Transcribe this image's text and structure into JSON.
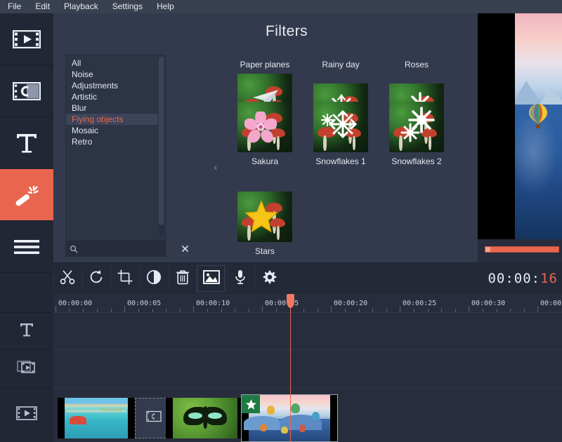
{
  "menubar": {
    "items": [
      {
        "label": "File"
      },
      {
        "label": "Edit"
      },
      {
        "label": "Playback"
      },
      {
        "label": "Settings"
      },
      {
        "label": "Help"
      }
    ]
  },
  "sidebar": {
    "items": [
      {
        "name": "import-media",
        "icon": "film-play-icon",
        "active": false
      },
      {
        "name": "transitions",
        "icon": "transition-icon",
        "active": false
      },
      {
        "name": "titles",
        "icon": "text-t-icon",
        "active": false
      },
      {
        "name": "filters",
        "icon": "magic-wand-icon",
        "active": true
      },
      {
        "name": "more",
        "icon": "hamburger-icon",
        "active": false
      }
    ],
    "accent_color": "#e8664f"
  },
  "panel": {
    "title": "Filters",
    "categories": [
      {
        "label": "All",
        "selected": false
      },
      {
        "label": "Noise",
        "selected": false
      },
      {
        "label": "Adjustments",
        "selected": false
      },
      {
        "label": "Artistic",
        "selected": false
      },
      {
        "label": "Blur",
        "selected": false
      },
      {
        "label": "Flying objects",
        "selected": true
      },
      {
        "label": "Mosaic",
        "selected": false
      },
      {
        "label": "Retro",
        "selected": false
      }
    ],
    "search": {
      "value": "",
      "placeholder": "",
      "clear_label": "×",
      "icon": "search-icon"
    },
    "collapse_icon": "‹",
    "filters": [
      {
        "label": "Paper planes",
        "overlay": "paper-plane",
        "position": "top-left"
      },
      {
        "label": "Rainy day",
        "overlay": "rain",
        "position": "top-center"
      },
      {
        "label": "Roses",
        "overlay": "rose",
        "position": "top-right"
      },
      {
        "label": "Sakura",
        "overlay": "sakura-flower",
        "position": "mid-left"
      },
      {
        "label": "Snowflakes 1",
        "overlay": "snowflake-single",
        "position": "mid-center"
      },
      {
        "label": "Snowflakes 2",
        "overlay": "snowflake-double",
        "position": "mid-right"
      },
      {
        "label": "Stars",
        "overlay": "star",
        "position": "bottom-left"
      }
    ]
  },
  "toolbar": {
    "buttons": [
      {
        "name": "split-button",
        "icon": "scissors-icon"
      },
      {
        "name": "rotate-button",
        "icon": "rotate-icon"
      },
      {
        "name": "crop-button",
        "icon": "crop-icon"
      },
      {
        "name": "color-adjust-button",
        "icon": "contrast-icon"
      },
      {
        "name": "delete-button",
        "icon": "trash-icon"
      },
      {
        "name": "image-button",
        "icon": "picture-icon"
      },
      {
        "name": "record-audio-button",
        "icon": "microphone-icon"
      },
      {
        "name": "properties-button",
        "icon": "gear-icon"
      }
    ],
    "timecode_main": "00:00:",
    "timecode_accent": "16"
  },
  "preview": {
    "progress_percent": 100,
    "scene": "hot-air-balloon-over-mountains"
  },
  "timeline": {
    "ruler_labels": [
      "00:00:00",
      "00:00:05",
      "00:00:10",
      "00:00:15",
      "00:00:20",
      "00:00:25",
      "00:00:30",
      "00:00"
    ],
    "playhead_time": "00:00:15",
    "tracks": [
      {
        "name": "title-track",
        "icon": "text-t-icon"
      },
      {
        "name": "overlay-track",
        "icon": "overlay-film-icon"
      },
      {
        "name": "video-track",
        "icon": "film-play-icon"
      }
    ],
    "clips": [
      {
        "name": "clip-beach",
        "selected": false,
        "badge": null
      },
      {
        "name": "transition-slot",
        "selected": false,
        "badge": null
      },
      {
        "name": "clip-butterfly",
        "selected": false,
        "badge": null
      },
      {
        "name": "clip-balloons",
        "selected": true,
        "badge": "star-badge"
      }
    ]
  }
}
